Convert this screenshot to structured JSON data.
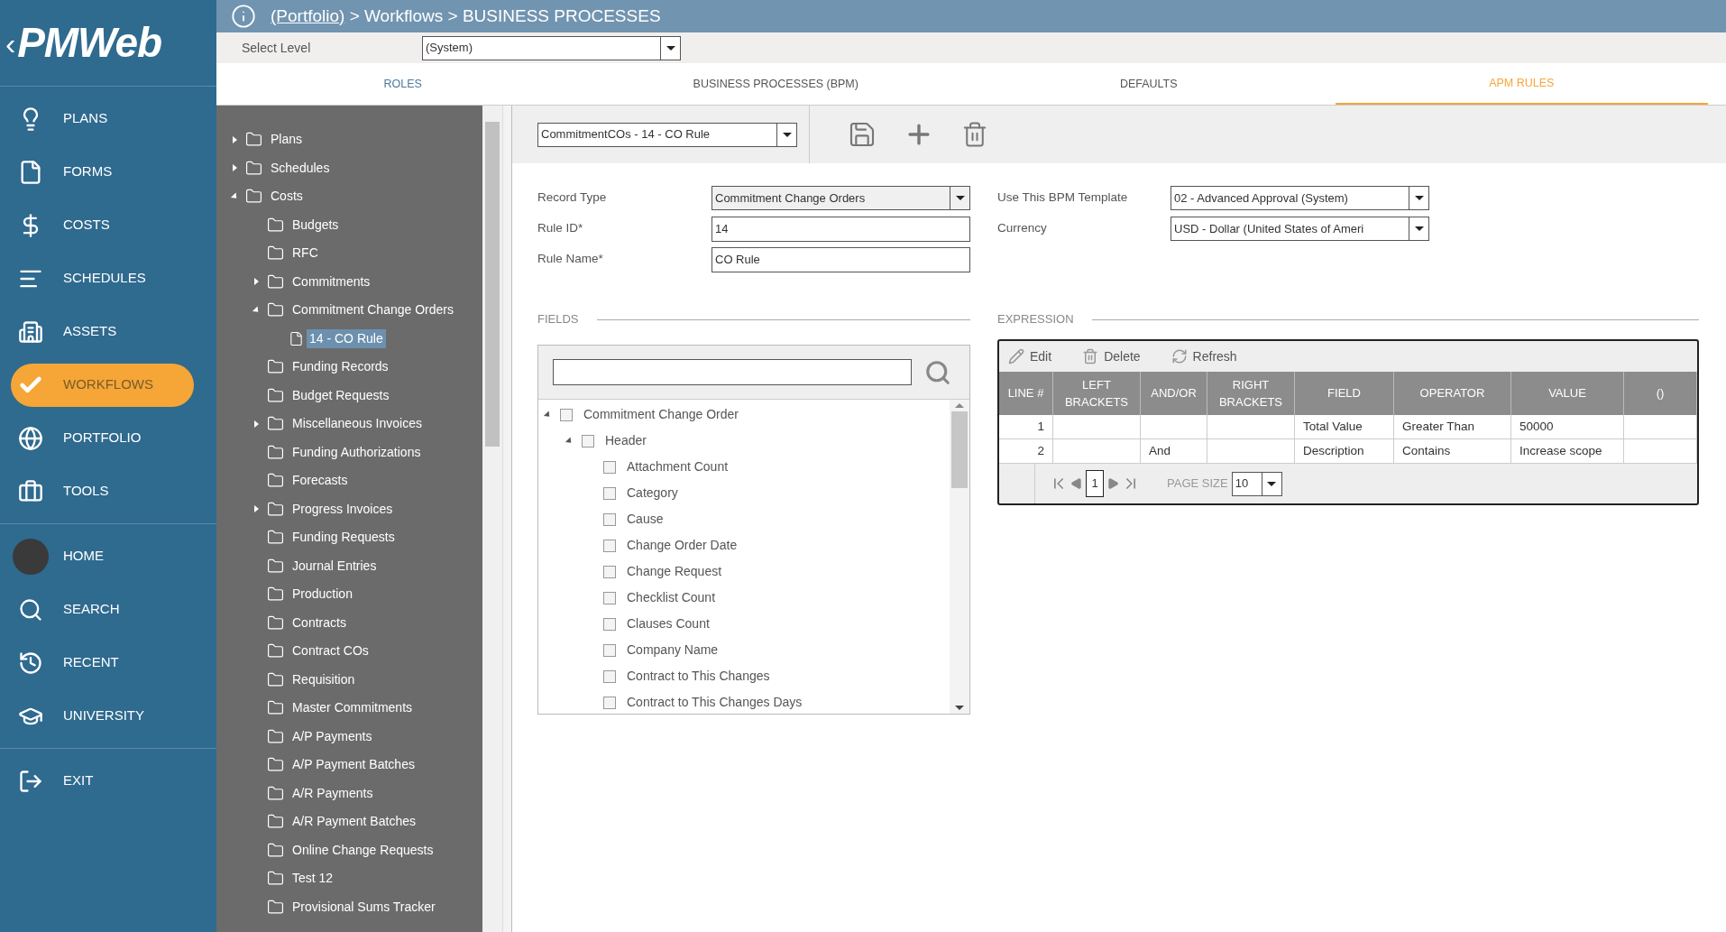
{
  "logo": {
    "text": "PMWeb",
    "back": "‹"
  },
  "header": {
    "breadcrumb_link": "(Portfolio)",
    "breadcrumb_rest": " > Workflows > BUSINESS PROCESSES"
  },
  "level": {
    "label": "Select Level",
    "value": "(System)"
  },
  "tabs": [
    {
      "label": "ROLES",
      "selected": false
    },
    {
      "label": "BUSINESS PROCESSES (BPM)",
      "selected": false
    },
    {
      "label": "DEFAULTS",
      "selected": false
    },
    {
      "label": "APM RULES",
      "selected": true
    }
  ],
  "nav": [
    [
      {
        "label": "PLANS",
        "selected": false
      },
      {
        "label": "FORMS",
        "selected": false
      },
      {
        "label": "COSTS",
        "selected": false
      },
      {
        "label": "SCHEDULES",
        "selected": false
      },
      {
        "label": "ASSETS",
        "selected": false
      },
      {
        "label": "WORKFLOWS",
        "selected": true
      },
      {
        "label": "PORTFOLIO",
        "selected": false
      },
      {
        "label": "TOOLS",
        "selected": false
      }
    ],
    [
      {
        "label": "HOME",
        "selected": false
      },
      {
        "label": "SEARCH",
        "selected": false
      },
      {
        "label": "RECENT",
        "selected": false
      },
      {
        "label": "UNIVERSITY",
        "selected": false
      }
    ],
    [
      {
        "label": "EXIT",
        "selected": false
      }
    ]
  ],
  "tree": [
    {
      "label": "Plans",
      "expanded": false,
      "selected": false
    },
    {
      "label": "Schedules",
      "expanded": false,
      "selected": false
    },
    {
      "label": "Costs",
      "expanded": true,
      "selected": false,
      "children": [
        {
          "label": "Budgets",
          "selected": false
        },
        {
          "label": "RFC",
          "selected": false
        },
        {
          "label": "Commitments",
          "expanded": false,
          "selected": false
        },
        {
          "label": "Commitment Change Orders",
          "expanded": true,
          "selected": false,
          "children": [
            {
              "label": "14 - CO Rule",
              "kind": "document",
              "selected": true
            }
          ]
        },
        {
          "label": "Funding Records",
          "selected": false
        },
        {
          "label": "Budget Requests",
          "selected": false
        },
        {
          "label": "Miscellaneous Invoices",
          "expanded": false,
          "selected": false
        },
        {
          "label": "Funding Authorizations",
          "selected": false
        },
        {
          "label": "Forecasts",
          "selected": false
        },
        {
          "label": "Progress Invoices",
          "expanded": false,
          "selected": false
        },
        {
          "label": "Funding Requests",
          "selected": false
        },
        {
          "label": "Journal Entries",
          "selected": false
        },
        {
          "label": "Production",
          "selected": false
        },
        {
          "label": "Contracts",
          "selected": false
        },
        {
          "label": "Contract COs",
          "selected": false
        },
        {
          "label": "Requisition",
          "selected": false
        },
        {
          "label": "Master Commitments",
          "selected": false
        },
        {
          "label": "A/P Payments",
          "selected": false
        },
        {
          "label": "A/P Payment Batches",
          "selected": false
        },
        {
          "label": "A/R Payments",
          "selected": false
        },
        {
          "label": "A/R Payment Batches",
          "selected": false
        },
        {
          "label": "Online Change Requests",
          "selected": false
        },
        {
          "label": "Test 12",
          "selected": false
        },
        {
          "label": "Provisional Sums Tracker",
          "selected": false
        }
      ]
    }
  ],
  "rule_select": {
    "value": "CommitmentCOs - 14 - CO Rule"
  },
  "form_left": [
    {
      "label": "Record Type",
      "value": "Commitment Change Orders",
      "kind": "dropdown"
    },
    {
      "label": "Rule ID*",
      "value": "14",
      "kind": "text"
    },
    {
      "label": "Rule Name*",
      "value": "CO Rule",
      "kind": "text"
    }
  ],
  "form_right": [
    {
      "label": "Use This BPM Template",
      "value": "02 - Advanced Approval (System)",
      "kind": "dropdown"
    },
    {
      "label": "Currency",
      "value": "USD - Dollar (United States of Ameri",
      "kind": "dropdown"
    }
  ],
  "fields": {
    "title": "FIELDS",
    "tree": [
      {
        "label": "Commitment Change Order",
        "expanded": true,
        "checked": false,
        "children": [
          {
            "label": "Header",
            "expanded": true,
            "checked": false,
            "children": [
              {
                "label": "Attachment Count",
                "checked": false
              },
              {
                "label": "Category",
                "checked": false
              },
              {
                "label": "Cause",
                "checked": false
              },
              {
                "label": "Change Order Date",
                "checked": false
              },
              {
                "label": "Change Request",
                "checked": false
              },
              {
                "label": "Checklist Count",
                "checked": false
              },
              {
                "label": "Clauses Count",
                "checked": false
              },
              {
                "label": "Company Name",
                "checked": false
              },
              {
                "label": "Contract to This Changes",
                "checked": false
              },
              {
                "label": "Contract to This Changes Days",
                "checked": false
              }
            ]
          }
        ]
      }
    ]
  },
  "expression": {
    "title": "EXPRESSION",
    "actions": [
      "Edit",
      "Delete",
      "Refresh"
    ],
    "columns": [
      "LINE #",
      "LEFT BRACKETS",
      "AND/OR",
      "RIGHT BRACKETS",
      "FIELD",
      "OPERATOR",
      "VALUE",
      "()"
    ],
    "rows": [
      [
        "1",
        "",
        "",
        "",
        "Total Value",
        "Greater Than",
        "50000",
        ""
      ],
      [
        "2",
        "",
        "And",
        "",
        "Description",
        "Contains",
        "Increase scope",
        ""
      ]
    ],
    "pager": {
      "page": "1",
      "page_size_label": "PAGE SIZE",
      "page_size": "10"
    }
  }
}
